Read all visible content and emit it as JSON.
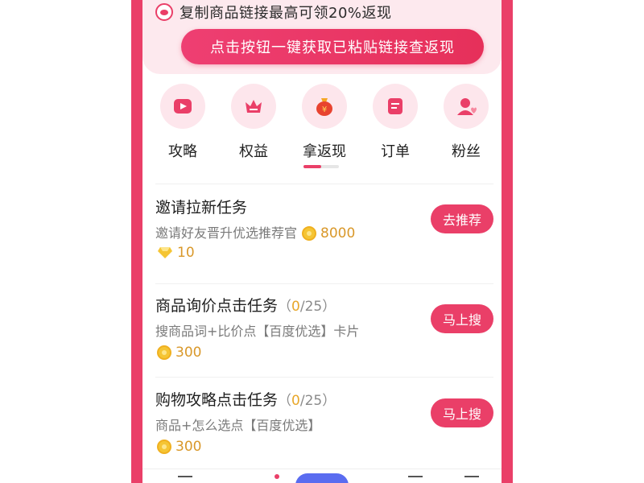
{
  "banner": {
    "text": "复制商品链接最高可领20%返现",
    "cta_label": "点击按钮一键获取已粘贴链接查返现"
  },
  "nav": {
    "items": [
      {
        "label": "攻略",
        "icon": "play-icon"
      },
      {
        "label": "权益",
        "icon": "crown-icon"
      },
      {
        "label": "拿返现",
        "icon": "money-bag-icon",
        "active": true
      },
      {
        "label": "订单",
        "icon": "order-list-icon"
      },
      {
        "label": "粉丝",
        "icon": "fans-icon"
      }
    ]
  },
  "tasks": [
    {
      "title": "邀请拉新任务",
      "progress_done": "",
      "progress_total": "",
      "desc": "邀请好友晋升优选推荐官",
      "reward_coins": "8000",
      "reward_gems": "10",
      "button": "去推荐"
    },
    {
      "title": "商品询价点击任务",
      "progress_done": "0",
      "progress_total": "/25）",
      "progress_open": "（",
      "desc": "搜商品词+比价点【百度优选】卡片",
      "reward_coins": "300",
      "button": "马上搜"
    },
    {
      "title": "购物攻略点击任务",
      "progress_done": "0",
      "progress_total": "/25）",
      "progress_open": "（",
      "desc": "商品+怎么选点【百度优选】",
      "reward_coins": "300",
      "button": "马上搜"
    }
  ],
  "colors": {
    "accent": "#ea3f68",
    "coin": "#f5c534",
    "reward_text": "#d9982a"
  }
}
